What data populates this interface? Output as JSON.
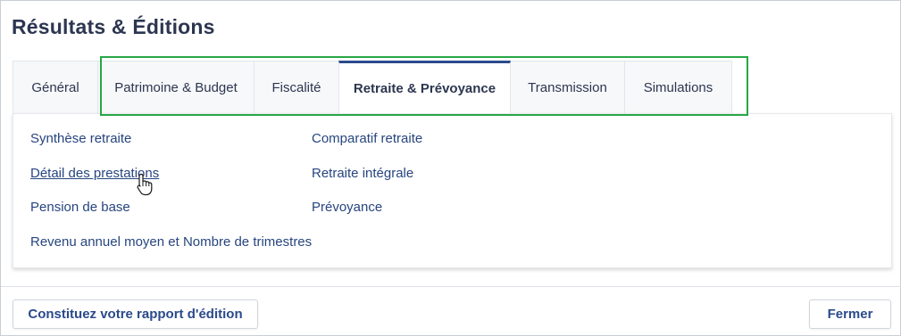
{
  "window": {
    "title": "Résultats & Éditions"
  },
  "tabs": [
    {
      "label": "Général"
    },
    {
      "label": "Patrimoine & Budget"
    },
    {
      "label": "Fiscalité"
    },
    {
      "label": "Retraite & Prévoyance"
    },
    {
      "label": "Transmission"
    },
    {
      "label": "Simulations"
    }
  ],
  "active_tab": "Retraite & Prévoyance",
  "panel": {
    "links": [
      {
        "label": "Synthèse retraite"
      },
      {
        "label": "Détail des prestations"
      },
      {
        "label": "Pension de base"
      },
      {
        "label": "Revenu annuel moyen et Nombre de trimestres"
      },
      {
        "label": "Comparatif retraite"
      },
      {
        "label": "Retraite intégrale"
      },
      {
        "label": "Prévoyance"
      }
    ]
  },
  "footer": {
    "rapport_label": "Constituez votre rapport d'édition",
    "fermer_label": "Fermer"
  },
  "colors": {
    "accent": "#2a4a8c",
    "link": "#27457f",
    "highlight": "#28a745",
    "title": "#2c3650"
  }
}
